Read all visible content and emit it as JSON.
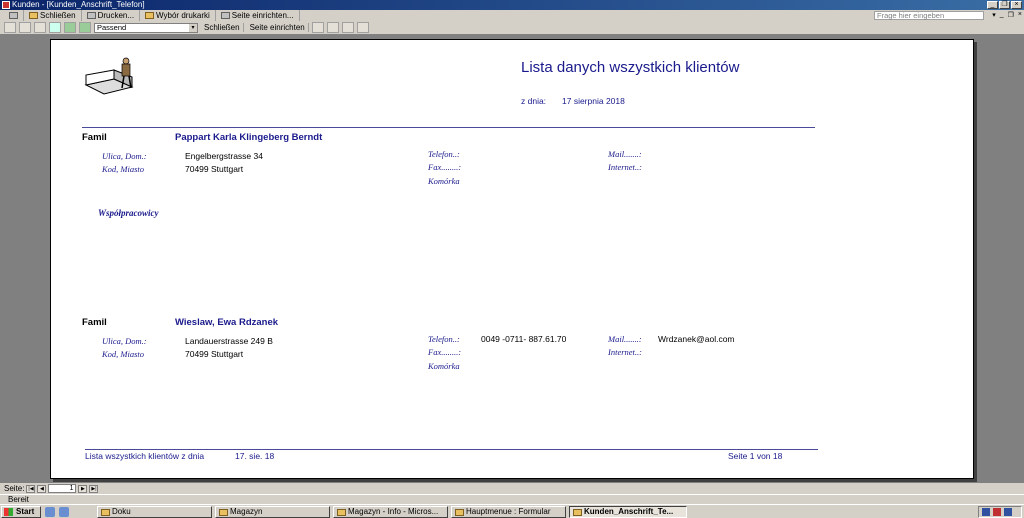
{
  "window": {
    "title": "Kunden - [Kunden_Anschrift_Telefon]"
  },
  "menu": {
    "close": "Schließen",
    "print": "Drucken...",
    "printer": "Wybór drukarki",
    "page_setup": "Seite einrichten...",
    "help_placeholder": "Frage hier eingeben"
  },
  "toolbar": {
    "zoom_value": "Passend",
    "close": "Schließen",
    "page_setup": "Seite einrichten"
  },
  "report": {
    "title": "Lista danych wszystkich klientów",
    "date_label": "z dnia:",
    "date_value": "17 sierpnia 2018",
    "fam_label": "Famil",
    "labels": {
      "street": "Ulica, Dom.:",
      "city": "Kod, Miasto",
      "phone": "Telefon..:",
      "fax": "Fax........:",
      "mobile": "Komórka",
      "mail": "Mail.......:",
      "internet": "Internet..:"
    },
    "coworkers": "Współpracowicy",
    "records": [
      {
        "name": "Pappart Karla Klingeberg Berndt",
        "street": "Engelbergstrasse 34",
        "city": "70499  Stuttgart",
        "phone": "",
        "fax": "",
        "mobile": "",
        "mail": "",
        "internet": ""
      },
      {
        "name": "Wieslaw, Ewa Rdzanek",
        "street": "Landauerstrasse 249 B",
        "city": "70499  Stuttgart",
        "phone": "0049 -0711- 887.61.70",
        "fax": "",
        "mobile": "",
        "mail": "Wrdzanek@aol.com",
        "internet": ""
      }
    ],
    "footer": {
      "left": "Lista wszystkich klientów z dnia",
      "date": "17. sie. 18",
      "page": "Seite 1 von 18"
    }
  },
  "nav": {
    "label": "Seite:",
    "current_page": "1"
  },
  "status": {
    "text": "Bereit"
  },
  "taskbar": {
    "start": "Start",
    "tasks": [
      "Doku",
      "Magazyn",
      "Magazyn - Info - Micros...",
      "Hauptmenue : Formular",
      "Kunden_Anschrift_Te..."
    ]
  },
  "colors": {
    "report_blue": "#1a1a8c",
    "title_bar": "#0a246a"
  }
}
